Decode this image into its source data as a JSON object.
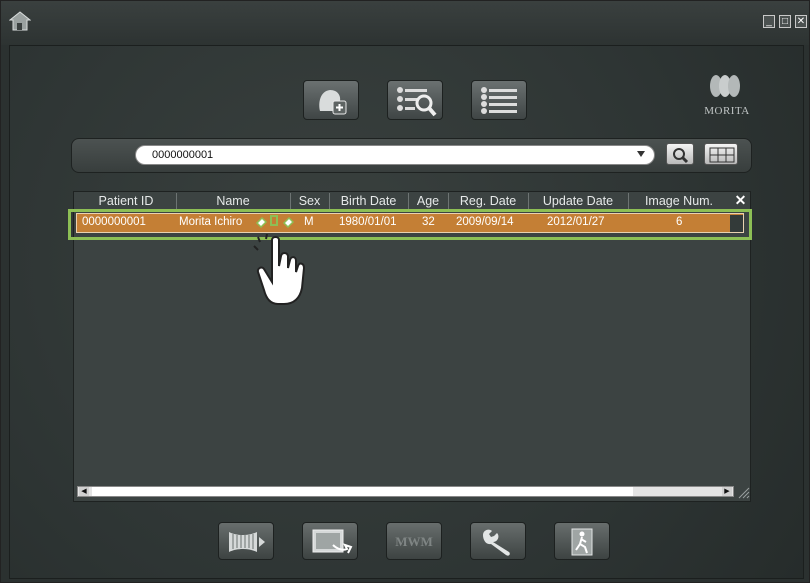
{
  "window": {
    "icons": {
      "home": "home-icon",
      "minimize": "minimize-icon",
      "maximize": "maximize-icon",
      "close": "close-icon"
    },
    "controls": {
      "minimize": "_",
      "maximize": "□",
      "close": "✕"
    }
  },
  "toolbar": {
    "buttons": [
      {
        "name": "new-patient-button",
        "icon": "add-patient-icon"
      },
      {
        "name": "search-patient-button",
        "icon": "list-search-icon"
      },
      {
        "name": "patient-list-button",
        "icon": "patient-list-icon"
      }
    ]
  },
  "logo": {
    "text": "MORITA"
  },
  "search": {
    "value": "0000000001",
    "icons": {
      "dropdown": "chevron-down-icon",
      "search": "magnifier-icon",
      "keypad": "numeric-keypad-icon"
    }
  },
  "table": {
    "columns": [
      "Patient ID",
      "Name",
      "Sex",
      "Birth Date",
      "Age",
      "Reg. Date",
      "Update Date",
      "Image Num."
    ],
    "clear_label": "✕",
    "rows": [
      {
        "patient_id": "0000000001",
        "name": "Morita Ichiro",
        "sex": "M",
        "birth_date": "1980/01/01",
        "age": "32",
        "reg_date": "2009/09/14",
        "update_date": "2012/01/27",
        "image_num": "6"
      }
    ]
  },
  "bottom_buttons": [
    {
      "name": "panoramic-button",
      "icon": "panoramic-icon"
    },
    {
      "name": "import-button",
      "icon": "image-import-icon"
    },
    {
      "name": "mwm-button",
      "label": "MWM"
    },
    {
      "name": "settings-button",
      "icon": "wrench-icon"
    },
    {
      "name": "exit-button",
      "icon": "exit-door-icon"
    }
  ],
  "colors": {
    "selected_row": "#c47f35",
    "highlight_outline": "#8dbf55",
    "background": "#2b3130"
  }
}
